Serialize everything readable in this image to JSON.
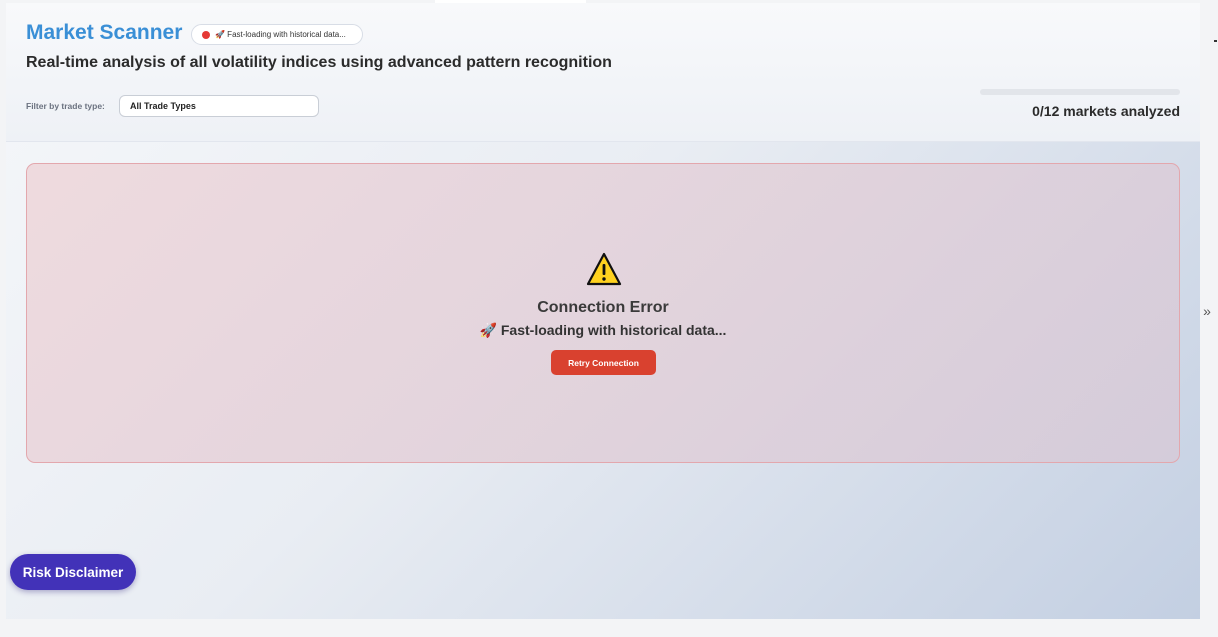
{
  "header": {
    "title": "Market Scanner",
    "status_pill": "🚀 Fast-loading with historical data...",
    "status_color": "#e53935",
    "subtitle": "Real-time analysis of all volatility indices using advanced pattern recognition",
    "filter_label": "Filter by trade type:",
    "filter_value": "All Trade Types",
    "progress_text": "0/12 markets analyzed",
    "progress_fraction": 0
  },
  "error": {
    "icon": "warning-icon",
    "title": "Connection Error",
    "message": "🚀 Fast-loading with historical data...",
    "retry_label": "Retry Connection"
  },
  "footer": {
    "risk_label": "Risk Disclaimer"
  },
  "side": {
    "collapse_glyph": "»"
  },
  "colors": {
    "brand": "#3a8fd6",
    "error": "#d9412f",
    "disclaimer": "#4232b8"
  }
}
